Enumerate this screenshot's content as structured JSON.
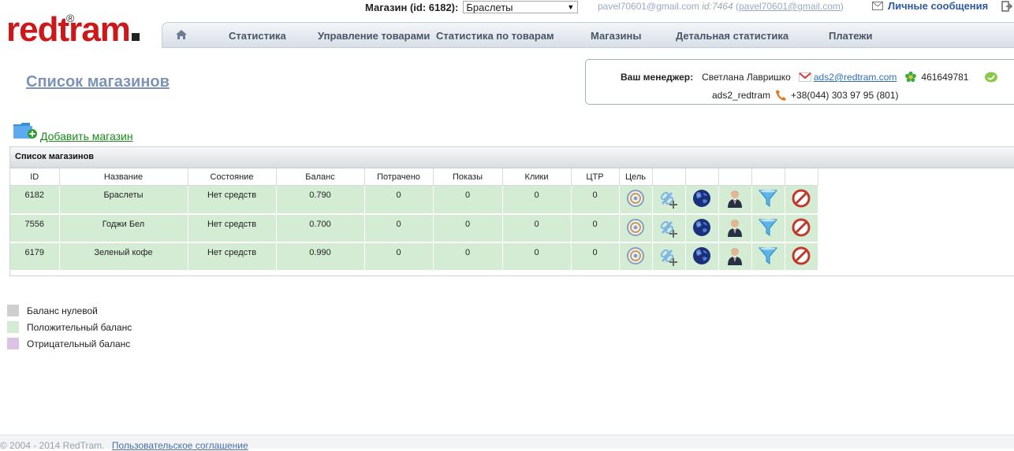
{
  "topbar": {
    "shop_label": "Магазин (id: 6182):",
    "shop_selected": "Браслеты",
    "user_email": "pavel70601@gmail.com",
    "user_id": "id:7464",
    "user_email_paren": "pavel70601@gmail.com",
    "messages_label": "Личные сообщения"
  },
  "logo": {
    "text": "redtram",
    "reg": "®"
  },
  "nav": {
    "items": [
      "Статистика",
      "Управление товарами",
      "Статистика по товарам",
      "Магазины",
      "Детальная статистика",
      "Платежи"
    ]
  },
  "page": {
    "title": "Список магазинов",
    "add_shop": "Добавить магазин"
  },
  "manager": {
    "label": "Ваш менеджер:",
    "name": "Светлана Лавришко",
    "email": "ads2@redtram.com",
    "icq": "461649781",
    "skype": "ads2_redtram",
    "phone": "+38(044) 303 97 95 (801)"
  },
  "table": {
    "title": "Список магазинов",
    "columns": [
      "ID",
      "Название",
      "Состояние",
      "Баланс",
      "Потрачено",
      "Показы",
      "Клики",
      "ЦТР",
      "Цель"
    ],
    "rows": [
      {
        "id": "6182",
        "name": "Браслеты",
        "state": "Нет средств",
        "balance": "0.790",
        "spent": "0",
        "views": "0",
        "clicks": "0",
        "ctr": "0"
      },
      {
        "id": "7556",
        "name": "Годжи Бел",
        "state": "Нет средств",
        "balance": "0.700",
        "spent": "0",
        "views": "0",
        "clicks": "0",
        "ctr": "0"
      },
      {
        "id": "6179",
        "name": "Зеленый кофе",
        "state": "Нет средств",
        "balance": "0.990",
        "spent": "0",
        "views": "0",
        "clicks": "0",
        "ctr": "0"
      }
    ],
    "row_icons": [
      "target-icon",
      "link-add-icon",
      "globe-icon",
      "manager-icon",
      "filter-icon",
      "delete-icon"
    ]
  },
  "legend": [
    {
      "label": "Баланс нулевой",
      "color": "#cfcfcf"
    },
    {
      "label": "Положительный баланс",
      "color": "#d4ecd4"
    },
    {
      "label": "Отрицательный баланс",
      "color": "#dcc3e6"
    }
  ],
  "footer": {
    "copyright": "© 2004 - 2014 RedTram.",
    "agreement": "Пользовательское соглашение"
  },
  "colors": {
    "accent": "#cc1818",
    "link": "#2f6fb0",
    "nav_text": "#485566",
    "row_positive": "#d4ecd4"
  }
}
